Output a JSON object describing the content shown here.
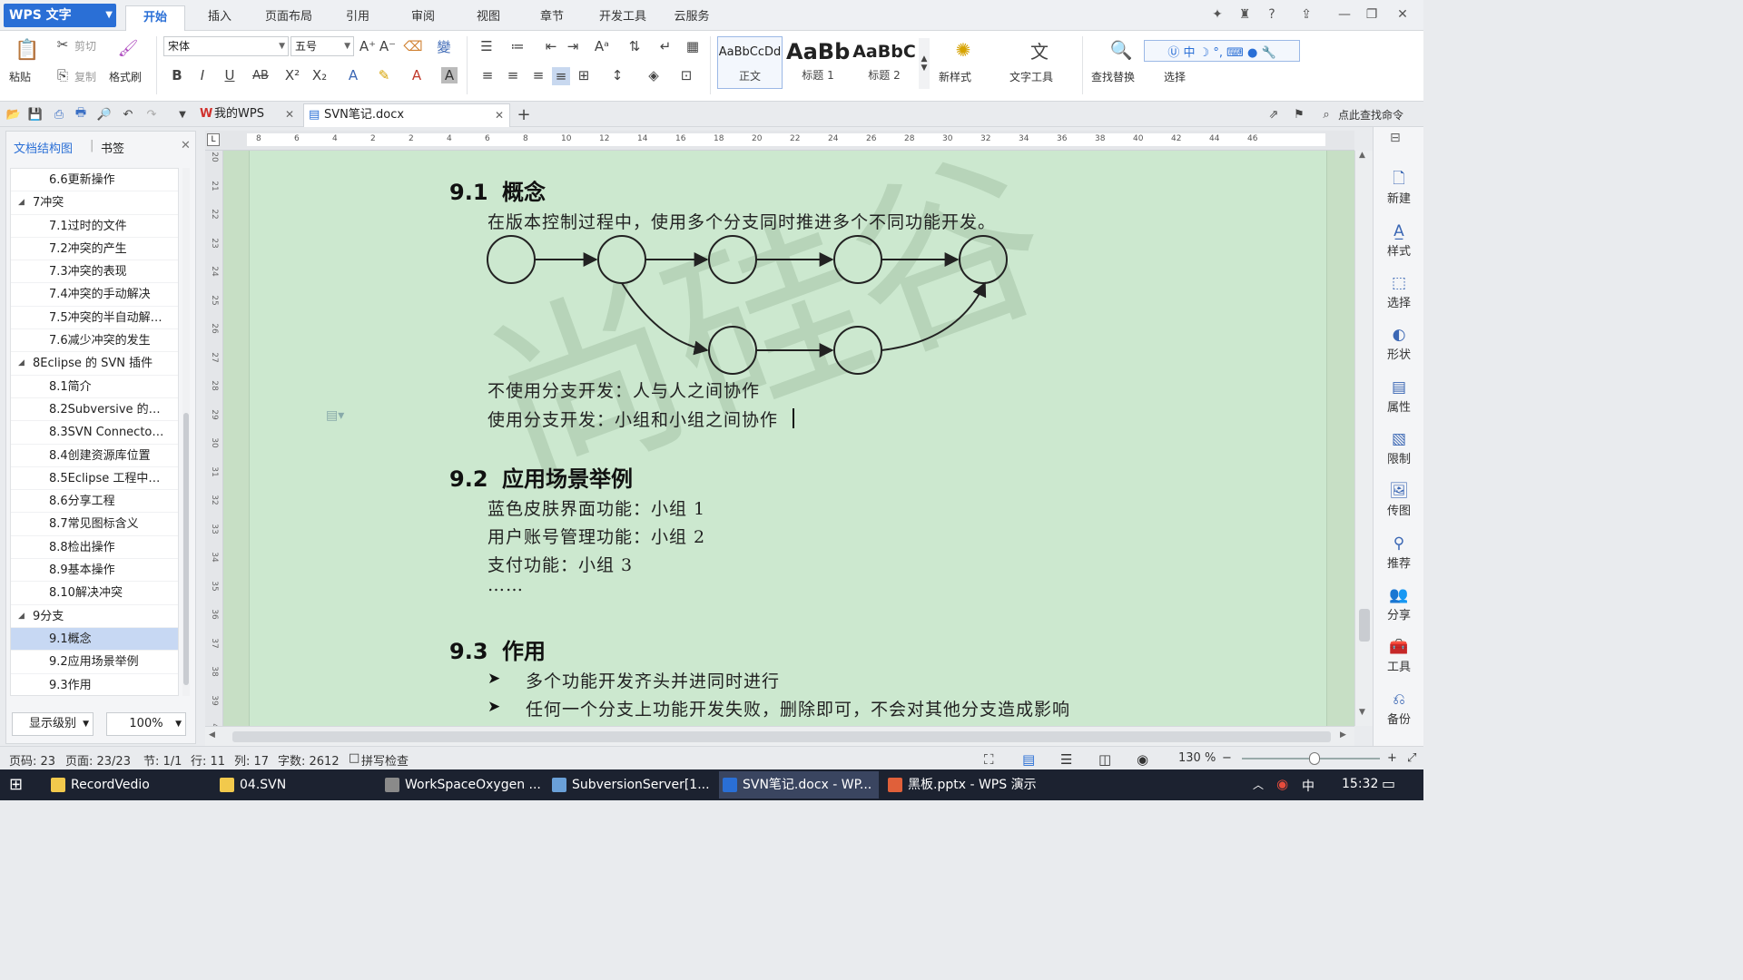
{
  "app": {
    "logo_text": "WPS 文字"
  },
  "menu": {
    "tabs": [
      "开始",
      "插入",
      "页面布局",
      "引用",
      "审阅",
      "视图",
      "章节",
      "开发工具",
      "云服务"
    ],
    "active": "开始"
  },
  "ribbon": {
    "paste": "粘贴",
    "cut": "剪切",
    "copy": "复制",
    "format_painter": "格式刷",
    "font_name": "宋体",
    "font_size": "五号",
    "styles": [
      {
        "sample": "AaBbCcDd",
        "name": "正文"
      },
      {
        "sample": "AaBb",
        "name": "标题 1"
      },
      {
        "sample": "AaBbC",
        "name": "标题 2"
      }
    ],
    "new_style": "新样式",
    "text_tools": "文字工具",
    "find_replace": "查找替换",
    "select": "选择"
  },
  "doc_tabs": [
    {
      "label": "我的WPS"
    },
    {
      "label": "SVN笔记.docx"
    }
  ],
  "search_command": "点此查找命令",
  "nav": {
    "tabs": [
      "文档结构图",
      "书签"
    ],
    "items": [
      {
        "label": "6.6更新操作",
        "level": 2
      },
      {
        "label": "7冲突",
        "level": 1
      },
      {
        "label": "7.1过时的文件",
        "level": 2
      },
      {
        "label": "7.2冲突的产生",
        "level": 2
      },
      {
        "label": "7.3冲突的表现",
        "level": 2
      },
      {
        "label": "7.4冲突的手动解决",
        "level": 2
      },
      {
        "label": "7.5冲突的半自动解…",
        "level": 2
      },
      {
        "label": "7.6减少冲突的发生",
        "level": 2
      },
      {
        "label": "8Eclipse 的 SVN 插件",
        "level": 1
      },
      {
        "label": "8.1简介",
        "level": 2
      },
      {
        "label": "8.2Subversive 的…",
        "level": 2
      },
      {
        "label": "8.3SVN Connecto…",
        "level": 2
      },
      {
        "label": "8.4创建资源库位置",
        "level": 2
      },
      {
        "label": "8.5Eclipse 工程中…",
        "level": 2
      },
      {
        "label": "8.6分享工程",
        "level": 2
      },
      {
        "label": "8.7常见图标含义",
        "level": 2
      },
      {
        "label": "8.8检出操作",
        "level": 2
      },
      {
        "label": "8.9基本操作",
        "level": 2
      },
      {
        "label": "8.10解决冲突",
        "level": 2
      },
      {
        "label": "9分支",
        "level": 1
      },
      {
        "label": "9.1概念",
        "level": 2,
        "selected": true
      },
      {
        "label": "9.2应用场景举例",
        "level": 2
      },
      {
        "label": "9.3作用",
        "level": 2
      }
    ],
    "display_level": "显示级别",
    "zoom": "100%"
  },
  "ruler": {
    "h_ticks": [
      "8",
      "6",
      "4",
      "2",
      "2",
      "4",
      "6",
      "8",
      "10",
      "12",
      "14",
      "16",
      "18",
      "20",
      "22",
      "24",
      "26",
      "28",
      "30",
      "32",
      "34",
      "36",
      "38",
      "40",
      "42",
      "44",
      "46"
    ],
    "v_ticks": [
      "20",
      "21",
      "22",
      "23",
      "24",
      "25",
      "26",
      "27",
      "28",
      "29",
      "30",
      "31",
      "32",
      "33",
      "34",
      "35",
      "36",
      "37",
      "38",
      "39",
      "40"
    ]
  },
  "document": {
    "s1": {
      "num": "9.1",
      "title": "概念"
    },
    "s1_intro": "在版本控制过程中，使用多个分支同时推进多个不同功能开发。",
    "s1_line1": "不使用分支开发：人与人之间协作",
    "s1_line2": "使用分支开发：小组和小组之间协作",
    "s2": {
      "num": "9.2",
      "title": "应用场景举例"
    },
    "s2_lines": [
      "蓝色皮肤界面功能：小组 1",
      "用户账号管理功能：小组 2",
      "支付功能：小组 3",
      "……"
    ],
    "s3": {
      "num": "9.3",
      "title": "作用"
    },
    "s3_bullets": [
      "多个功能开发齐头并进同时进行",
      "任何一个分支上功能开发失败，删除即可，不会对其他分支造成影响"
    ],
    "bullet_glyph": "➤"
  },
  "sidebar": [
    "新建",
    "样式",
    "选择",
    "形状",
    "属性",
    "限制",
    "传图",
    "推荐",
    "分享",
    "工具",
    "备份"
  ],
  "status": {
    "page_code": "页码: 23",
    "page": "页面: 23/23",
    "section": "节: 1/1",
    "row": "行: 11",
    "col": "列: 17",
    "words": "字数: 2612",
    "spell": "拼写检查",
    "zoom": "130 %"
  },
  "taskbar": {
    "items": [
      {
        "label": "RecordVedio",
        "color": "#f2c94c"
      },
      {
        "label": "04.SVN",
        "color": "#f2c94c"
      },
      {
        "label": "WorkSpaceOxygen ...",
        "color": "#8a8a8a"
      },
      {
        "label": "SubversionServer[1...",
        "color": "#6aa0d8"
      },
      {
        "label": "SVN笔记.docx - WP...",
        "color": "#2a6fd6",
        "active": true
      },
      {
        "label": "黑板.pptx - WPS 演示",
        "color": "#e0603a"
      }
    ],
    "ime": "中",
    "time": "15:32"
  },
  "colors": {
    "accent": "#2a6fd6",
    "page_bg": "#cce8cf",
    "canvas_bg": "#c7dfc5",
    "nav_selected": "#c7d8f3"
  }
}
